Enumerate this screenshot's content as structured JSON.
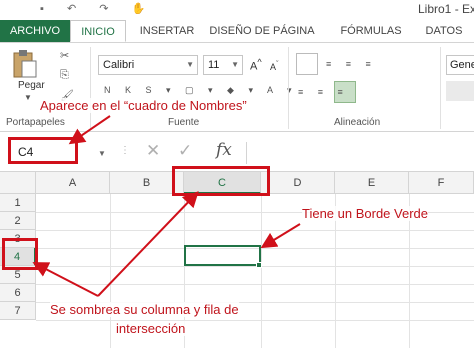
{
  "window": {
    "title": "Libro1 - Ex"
  },
  "ribbon_tabs": [
    "ARCHIVO",
    "INICIO",
    "INSERTAR",
    "DISEÑO DE PÁGINA",
    "FÓRMULAS",
    "DATOS"
  ],
  "ribbon": {
    "paste_label": "Pegar",
    "font_name": "Calibri",
    "font_size": "11",
    "number_format": "Gene",
    "groups": {
      "clipboard": "Portapapeles",
      "font": "Fuente",
      "alignment": "Alineación"
    }
  },
  "formula_bar": {
    "name_box": "C4",
    "fx": "fx",
    "content": ""
  },
  "grid": {
    "columns": [
      "A",
      "B",
      "C",
      "D",
      "E",
      "F"
    ],
    "rows": [
      "1",
      "2",
      "3",
      "4",
      "5",
      "6",
      "7"
    ],
    "selected_column": "C",
    "selected_row": "4"
  },
  "annotations": {
    "name_box_note": "Aparece en el “cuadro de Nombres”",
    "green_border_note": "Tiene un Borde Verde",
    "shade_note_line1": "Se sombrea su columna y fila de",
    "shade_note_line2": "intersección"
  },
  "colors": {
    "excel_green": "#217346",
    "annotation_red": "#d0101a"
  }
}
